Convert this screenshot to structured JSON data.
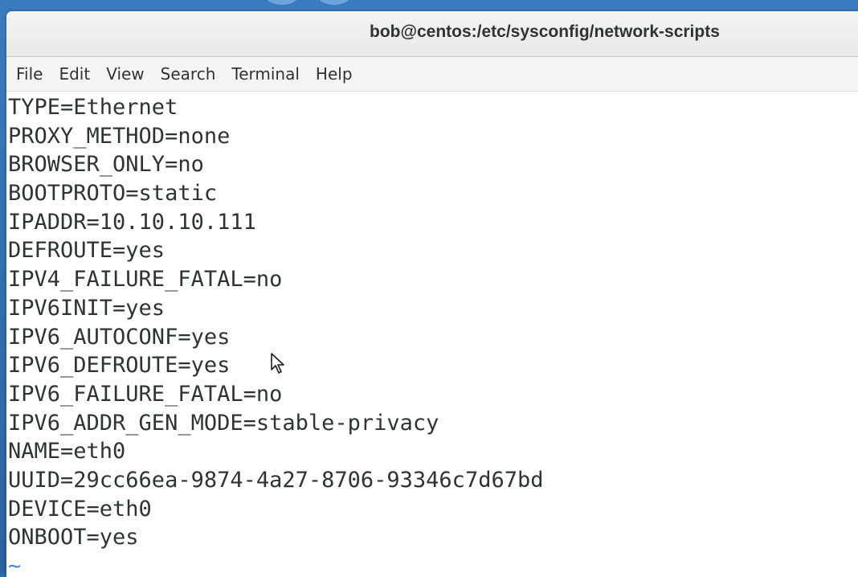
{
  "window": {
    "title": "bob@centos:/etc/sysconfig/network-scripts"
  },
  "menubar": {
    "items": [
      {
        "label": "File"
      },
      {
        "label": "Edit"
      },
      {
        "label": "View"
      },
      {
        "label": "Search"
      },
      {
        "label": "Terminal"
      },
      {
        "label": "Help"
      }
    ]
  },
  "terminal": {
    "lines": [
      "TYPE=Ethernet",
      "PROXY_METHOD=none",
      "BROWSER_ONLY=no",
      "BOOTPROTO=static",
      "IPADDR=10.10.10.111",
      "DEFROUTE=yes",
      "IPV4_FAILURE_FATAL=no",
      "IPV6INIT=yes",
      "IPV6_AUTOCONF=yes",
      "IPV6_DEFROUTE=yes",
      "IPV6_FAILURE_FATAL=no",
      "IPV6_ADDR_GEN_MODE=stable-privacy",
      "NAME=eth0",
      "UUID=29cc66ea-9874-4a27-8706-93346c7d67bd",
      "DEVICE=eth0",
      "ONBOOT=yes"
    ],
    "empty_line_marker": "~"
  },
  "colors": {
    "text": "#2e3436",
    "tilde": "#4a7fd6",
    "background": "#ffffff",
    "desktop": "#3a7bc0"
  },
  "icons": {
    "pointer": "mouse-pointer-icon"
  }
}
